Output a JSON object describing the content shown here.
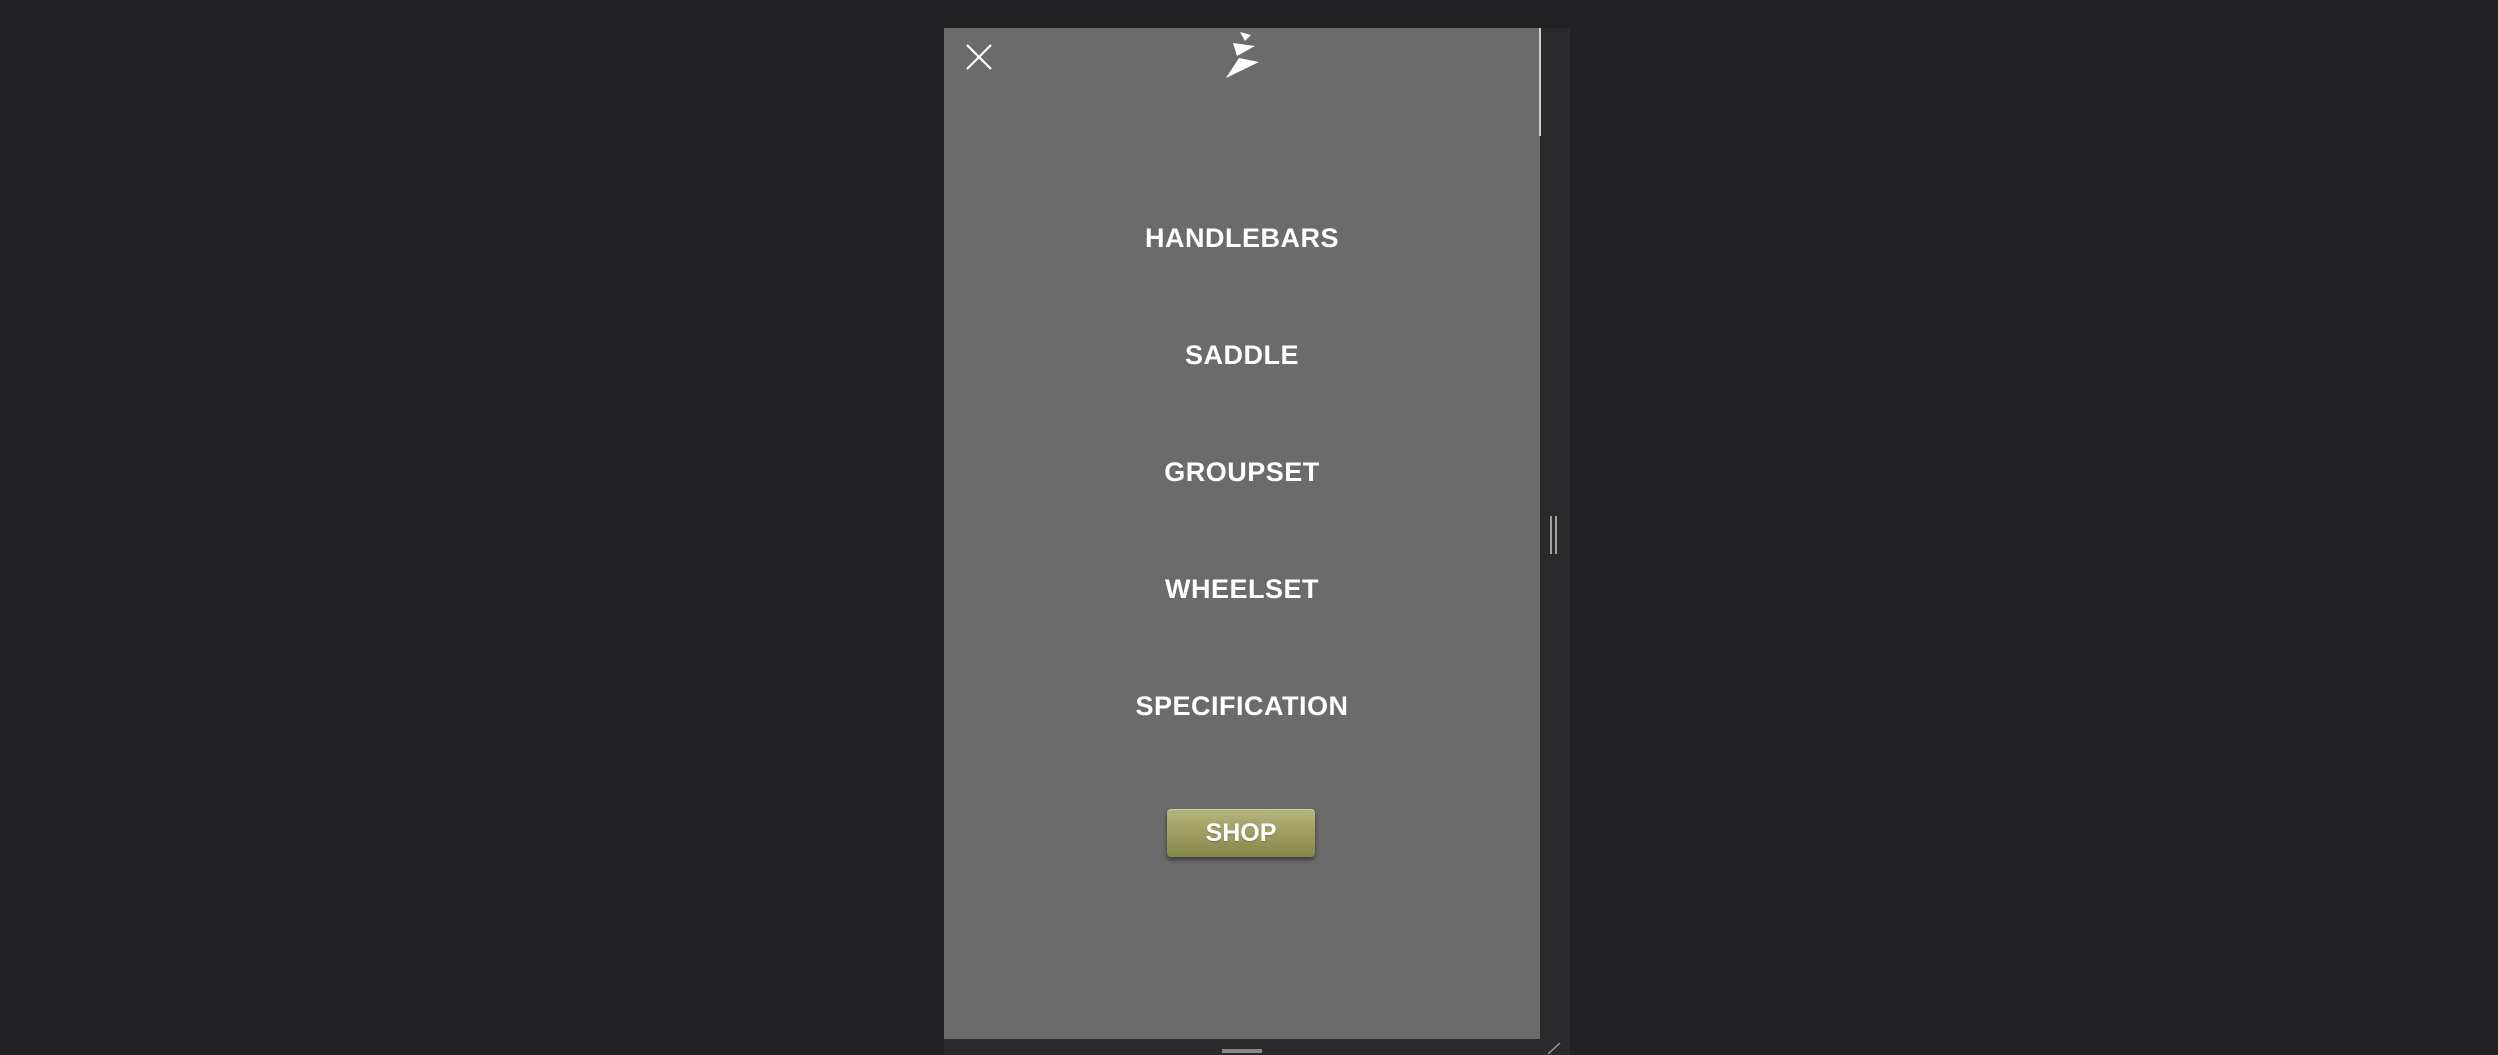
{
  "menu": {
    "items": [
      {
        "label": "HANDLEBARS"
      },
      {
        "label": "SADDLE"
      },
      {
        "label": "GROUPSET"
      },
      {
        "label": "WHEELSET"
      },
      {
        "label": "SPECIFICATION"
      }
    ],
    "shop_label": "SHOP"
  },
  "icons": {
    "close": "close-icon",
    "logo": "brand-logo-icon"
  },
  "colors": {
    "page_background": "#222224",
    "panel_background": "#6b6b6b",
    "text": "#ffffff",
    "shop_button": "#9c9c60"
  }
}
